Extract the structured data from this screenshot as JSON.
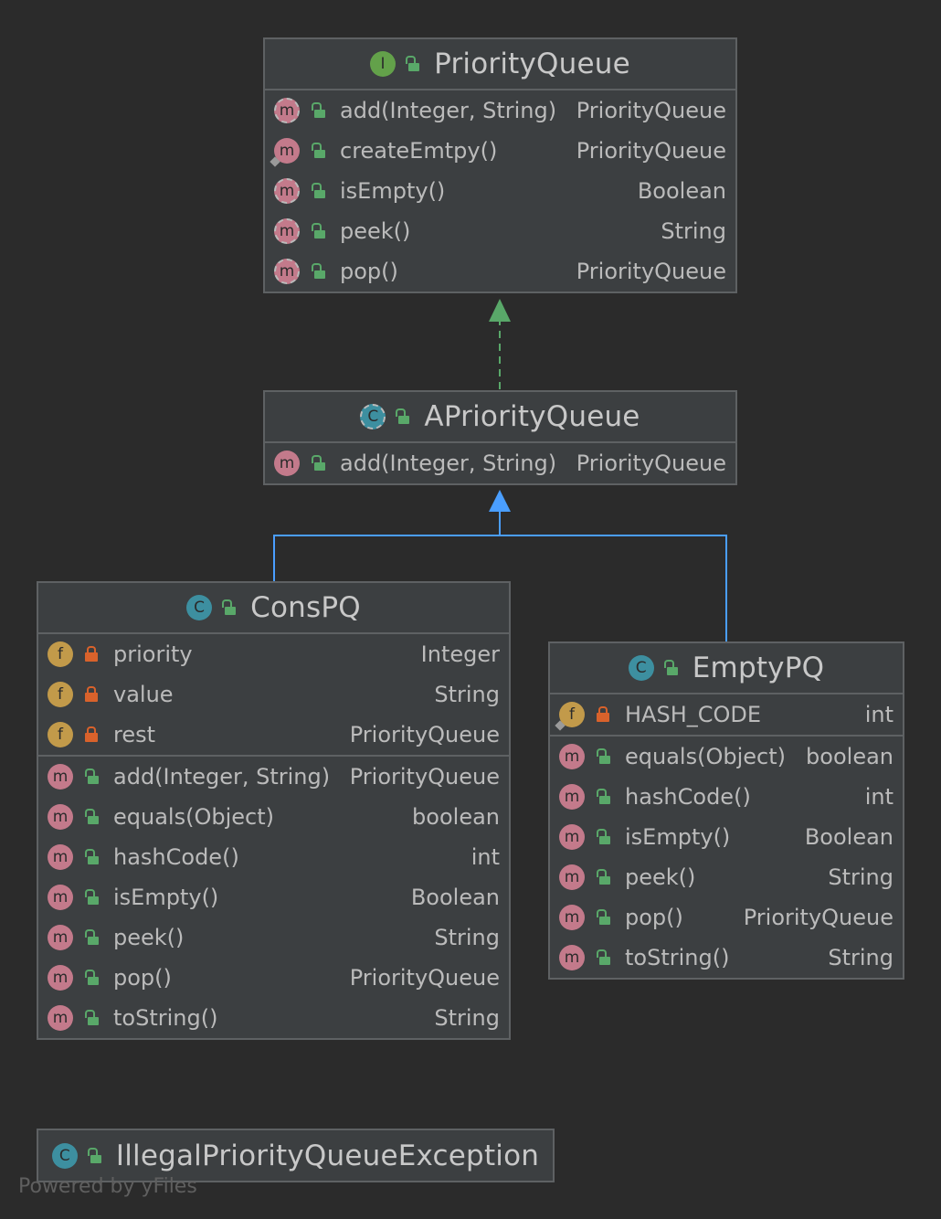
{
  "classes": {
    "priority_queue": {
      "name": "PriorityQueue",
      "kind_icon": "interface-icon",
      "kind_letter": "I",
      "methods": [
        {
          "name": "add(Integer, String)",
          "type": "PriorityQueue"
        },
        {
          "name": "createEmtpy()",
          "type": "PriorityQueue"
        },
        {
          "name": "isEmpty()",
          "type": "Boolean"
        },
        {
          "name": "peek()",
          "type": "String"
        },
        {
          "name": "pop()",
          "type": "PriorityQueue"
        }
      ]
    },
    "a_priority_queue": {
      "name": "APriorityQueue",
      "kind_icon": "abstract-class-icon",
      "kind_letter": "C",
      "methods": [
        {
          "name": "add(Integer, String)",
          "type": "PriorityQueue"
        }
      ]
    },
    "cons_pq": {
      "name": "ConsPQ",
      "kind_icon": "class-icon",
      "kind_letter": "C",
      "fields": [
        {
          "name": "priority",
          "type": "Integer"
        },
        {
          "name": "value",
          "type": "String"
        },
        {
          "name": "rest",
          "type": "PriorityQueue"
        }
      ],
      "methods": [
        {
          "name": "add(Integer, String)",
          "type": "PriorityQueue"
        },
        {
          "name": "equals(Object)",
          "type": "boolean"
        },
        {
          "name": "hashCode()",
          "type": "int"
        },
        {
          "name": "isEmpty()",
          "type": "Boolean"
        },
        {
          "name": "peek()",
          "type": "String"
        },
        {
          "name": "pop()",
          "type": "PriorityQueue"
        },
        {
          "name": "toString()",
          "type": "String"
        }
      ]
    },
    "empty_pq": {
      "name": "EmptyPQ",
      "kind_icon": "class-icon",
      "kind_letter": "C",
      "fields": [
        {
          "name": "HASH_CODE",
          "type": "int"
        }
      ],
      "methods": [
        {
          "name": "equals(Object)",
          "type": "boolean"
        },
        {
          "name": "hashCode()",
          "type": "int"
        },
        {
          "name": "isEmpty()",
          "type": "Boolean"
        },
        {
          "name": "peek()",
          "type": "String"
        },
        {
          "name": "pop()",
          "type": "PriorityQueue"
        },
        {
          "name": "toString()",
          "type": "String"
        }
      ]
    },
    "exception": {
      "name": "IllegalPriorityQueueException",
      "kind_icon": "class-icon",
      "kind_letter": "C"
    }
  },
  "icon_letters": {
    "method": "m",
    "field": "f"
  },
  "footer": "Powered by yFiles",
  "colors": {
    "background": "#2b2b2b",
    "box": "#3c3f41",
    "border": "#5e6163",
    "implements_arrow": "#59a869",
    "extends_arrow": "#4a9eff",
    "method_icon": "#c37a8b",
    "field_icon": "#c29a4a",
    "class_icon": "#3d8fa0",
    "interface_icon": "#63a14a"
  }
}
